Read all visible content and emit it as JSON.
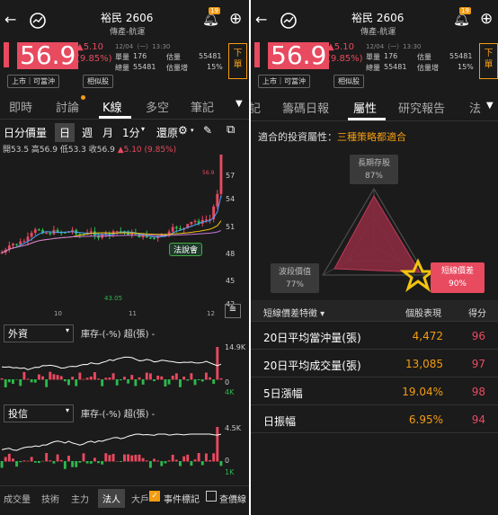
{
  "left": {
    "title": "裕民 2606",
    "subtitle": "傳產-航運",
    "badge": "19",
    "price": "56.9",
    "change": "▲5.10",
    "change_pct": "(9.85%)",
    "time": "12/04（一）13:30",
    "stats": {
      "single_label": "單量",
      "single_val": "176",
      "est_label": "估量",
      "est_val": "55481",
      "total_label": "總量",
      "total_val": "55481",
      "inc_label": "估量增",
      "inc_val": "15%"
    },
    "tag_listed": "上市｜可當沖",
    "tag_related": "相似股",
    "order_btn": "下單",
    "tabs": [
      "即時",
      "討論",
      "K線",
      "多空",
      "筆記"
    ],
    "toolbar": {
      "type": "日分價量",
      "day": "日",
      "week": "週",
      "month": "月",
      "min": "1分",
      "restore": "還原"
    },
    "ohlc": {
      "open": "開53.5",
      "high": "高56.9",
      "low": "低53.3",
      "close": "收56.9",
      "chg": "▲5.10 (9.85%)"
    },
    "price_axis": [
      "57",
      "54",
      "51",
      "48",
      "45",
      "42"
    ],
    "annotations": {
      "hi": "56.9",
      "lo": "43.05",
      "bubble": "法說會"
    },
    "date_labels": [
      "10",
      "11",
      "12"
    ],
    "foreign": {
      "select": "外資",
      "label": "庫存-(-%) 超(張) -",
      "top": "14.9K",
      "zero": "0",
      "bottom": "4K"
    },
    "trust": {
      "select": "投信",
      "label": "庫存-(-%) 超(張) -",
      "top": "4.5K",
      "zero": "0",
      "bottom": "1K"
    },
    "bottom_tabs": [
      "成交量",
      "技術",
      "主力",
      "法人",
      "大戶"
    ],
    "event_mark": "事件標記",
    "check_line": "查價線"
  },
  "right": {
    "title": "裕民 2606",
    "subtitle": "傳產-航運",
    "badge": "19",
    "price": "56.9",
    "change": "▲5.10",
    "change_pct": "(9.85%)",
    "time": "12/04（一）13:30",
    "stats": {
      "single_label": "單量",
      "single_val": "176",
      "est_label": "估量",
      "est_val": "55481",
      "total_label": "總量",
      "total_val": "55481",
      "inc_label": "估量增",
      "inc_val": "15%"
    },
    "tag_listed": "上市｜可當沖",
    "tag_related": "相似股",
    "order_btn": "下單",
    "tabs": [
      "記",
      "籌碼日報",
      "屬性",
      "研究報告",
      "法"
    ],
    "attr_prefix": "適合的投資屬性：",
    "attr_value": "三種策略都適合",
    "radar": {
      "top_label": "長期存股",
      "top_val": "87%",
      "left_label": "波段價值",
      "left_val": "77%",
      "right_label": "短線價差",
      "right_val": "90%"
    },
    "table": {
      "col1": "短線價差特徵 ▾",
      "col2": "個股表現",
      "col3": "得分",
      "rows": [
        {
          "name": "20日平均當沖量(張)",
          "val": "4,472",
          "score": "96"
        },
        {
          "name": "20日平均成交量(張)",
          "val": "13,085",
          "score": "97"
        },
        {
          "name": "5日漲幅",
          "val": "19.04%",
          "score": "98"
        },
        {
          "name": "日振幅",
          "val": "6.95%",
          "score": "94"
        }
      ]
    }
  },
  "colors": {
    "up": "#e84a5f",
    "down": "#2db84d",
    "accent": "#f39c12",
    "bg": "#1b1b1b"
  }
}
